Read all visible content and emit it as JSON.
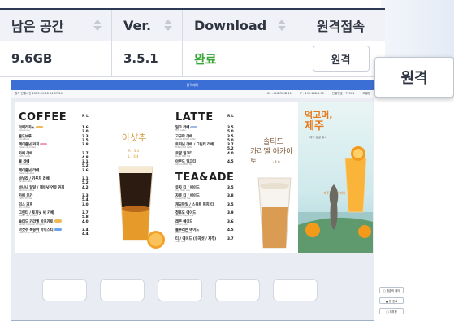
{
  "table": {
    "headers": [
      "남은 공간",
      "Ver.",
      "Download",
      "원격접속"
    ],
    "row": {
      "space": "9.6GB",
      "version": "3.5.1",
      "download": "완료",
      "remote_button": "원격"
    }
  },
  "popup_button": "원격",
  "window": {
    "title": "원격제어",
    "info_left": "접속 연결시간  2023-09-18 14:57:24",
    "info_right": [
      "CS : ANDROID 11",
      "IP : 192.168.0.35",
      "단말번호 : 77561",
      "모델명"
    ]
  },
  "menu": {
    "coffee": {
      "head": "COFFEE",
      "rl": "R  L",
      "items": [
        {
          "name": "아메리카노",
          "sub": "Americano",
          "price": "1.6 3.0",
          "pill": "#f0b95b"
        },
        {
          "name": "콜드브루",
          "sub": "Cold Brew",
          "price": "2.3 3.5",
          "pill": ""
        },
        {
          "name": "헤이즐넛 커피",
          "sub": "Hazelnut Coffee",
          "price": "3.8",
          "pill": "#f29ab8"
        },
        {
          "name": "카페 라떼",
          "sub": "Caffe Latte",
          "price": "2.7 4.8",
          "pill": ""
        },
        {
          "name": "콜 라떼",
          "sub": "Cold Latte",
          "price": "3.1 5.2",
          "pill": ""
        },
        {
          "name": "헤이즐넛 라떼",
          "sub": "Hazelnut Latte",
          "price": "3.6",
          "pill": ""
        },
        {
          "name": "바닐라 / 카푸치 라떼",
          "sub": "Vanilla Latte",
          "price": "3.1 5.2",
          "pill": ""
        },
        {
          "name": "바나나 달달 / 헤이넛 연유 커피",
          "sub": "Banana Coffee",
          "price": "4.2",
          "pill": ""
        },
        {
          "name": "카페 모카",
          "sub": "Caffe Mocha",
          "price": "3.3 5.4",
          "pill": ""
        },
        {
          "name": "믹스 커피",
          "sub": "Mix Coffee",
          "price": "3.0",
          "pill": ""
        },
        {
          "name": "그린티 / 토피넛 쉐 카페",
          "sub": "Green Tea Coffee",
          "price": "3.7 5.8",
          "pill": ""
        },
        {
          "name": "솔티드 카라멜 아포카토",
          "sub": "Salted Caramel Affogato",
          "price": "4.0",
          "pill": "#f0b95b"
        },
        {
          "name": "아샷추 복숭아 아이스티",
          "sub": "Peach Iced Tea Shot",
          "price": "3.4 4.4",
          "pill": "#6aa6f0"
        }
      ]
    },
    "promo1": {
      "title": "아샷추",
      "sub1": "R - 3.4",
      "sub2": "L - 4.4"
    },
    "latte": {
      "head": "LATTE",
      "rl": "R  L",
      "items": [
        {
          "name": "밀크 라떼",
          "sub": "Milk Latte",
          "price": "3.5 5.0",
          "pill": "#a3b8e8"
        },
        {
          "name": "고구마 라떼",
          "sub": "Sweet Potato Latte",
          "price": "3.5 5.0",
          "pill": ""
        },
        {
          "name": "토피넛 라떼 / 그린티 라떼",
          "sub": "Toffee Nut Latte",
          "price": "3.7 5.2",
          "pill": ""
        },
        {
          "name": "로얄 밀크티",
          "sub": "Royal Milk Tea",
          "price": "4.0",
          "pill": ""
        },
        {
          "name": "아몬드 밀크티",
          "sub": "Almond Milk Tea",
          "price": "4.5",
          "pill": ""
        }
      ]
    },
    "tea": {
      "head": "TEA&ADE",
      "items": [
        {
          "name": "유자 티 / 에이드",
          "sub": "Yuja Tea / Ade",
          "price": "3.5",
          "pill": ""
        },
        {
          "name": "자몽 티 / 에이드",
          "sub": "Grapefruit Tea",
          "price": "3.8",
          "pill": ""
        },
        {
          "name": "캐모마일 / 스위트 피치 티",
          "sub": "Chamomile Tea",
          "price": "3.5",
          "pill": ""
        },
        {
          "name": "청포도 에이드",
          "sub": "Green Grape Ade",
          "price": "3.9",
          "pill": ""
        },
        {
          "name": "레몬 에이드",
          "sub": "Lemon Ade",
          "price": "3.6",
          "pill": ""
        },
        {
          "name": "블루레몬 에이드",
          "sub": "Blue Lemon Ade",
          "price": "4.5",
          "pill": ""
        },
        {
          "name": "티 / 에이드 (유자샷 / 제주)",
          "sub": "Tea / Ade",
          "price": "3.7",
          "pill": ""
        }
      ]
    },
    "promo2": {
      "title1": "솔티드",
      "title2": "카라멜 아카아토",
      "sub": "L - 4.0"
    },
    "promo3": {
      "title1": "먹고머,",
      "title2": "제주",
      "sub": "제주 감귤 쥬스",
      "cap": "제주 감귤 / 에이드"
    }
  },
  "side_buttons": [
    "□ 원클릭 제어",
    "■ 앱 종료",
    "□ 재부팅"
  ]
}
